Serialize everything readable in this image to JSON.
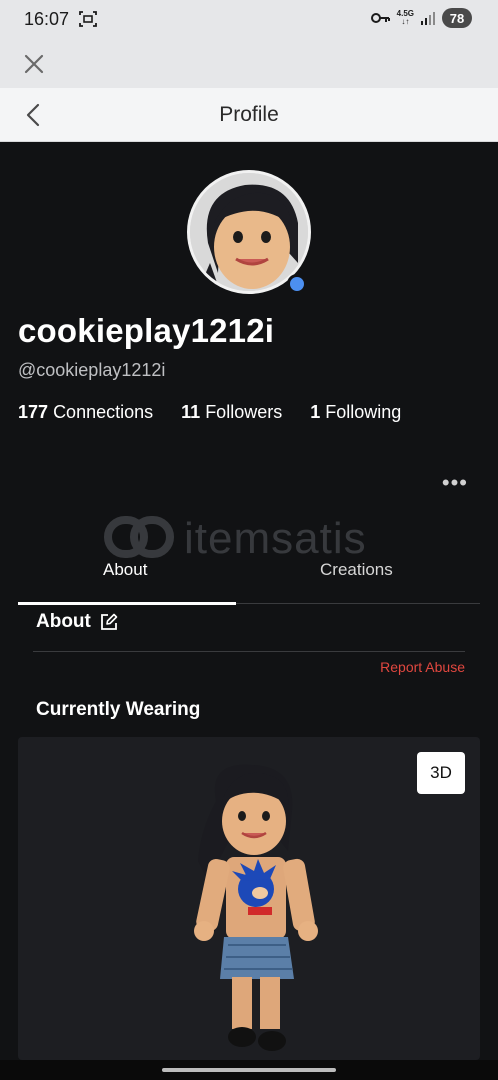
{
  "status_bar": {
    "time": "16:07",
    "network": "4.5G",
    "battery": "78",
    "icons": [
      "screenshot-icon",
      "vpn-key-icon",
      "signal-icon",
      "battery-icon"
    ]
  },
  "nav": {
    "title": "Profile"
  },
  "profile": {
    "display_name": "cookieplay1212i",
    "username": "@cookieplay1212i",
    "online_color": "#4c8ff0",
    "stats": {
      "connections_count": "177",
      "connections_label": "Connections",
      "followers_count": "11",
      "followers_label": "Followers",
      "following_count": "1",
      "following_label": "Following"
    },
    "more_label": "•••"
  },
  "watermark": {
    "text": "itemsatis"
  },
  "tabs": [
    {
      "label": "About",
      "active": true
    },
    {
      "label": "Creations",
      "active": false
    }
  ],
  "about": {
    "heading": "About",
    "report_abuse": "Report Abuse",
    "report_color": "#e0473f"
  },
  "wearing": {
    "heading": "Currently Wearing",
    "view_3d_label": "3D"
  }
}
